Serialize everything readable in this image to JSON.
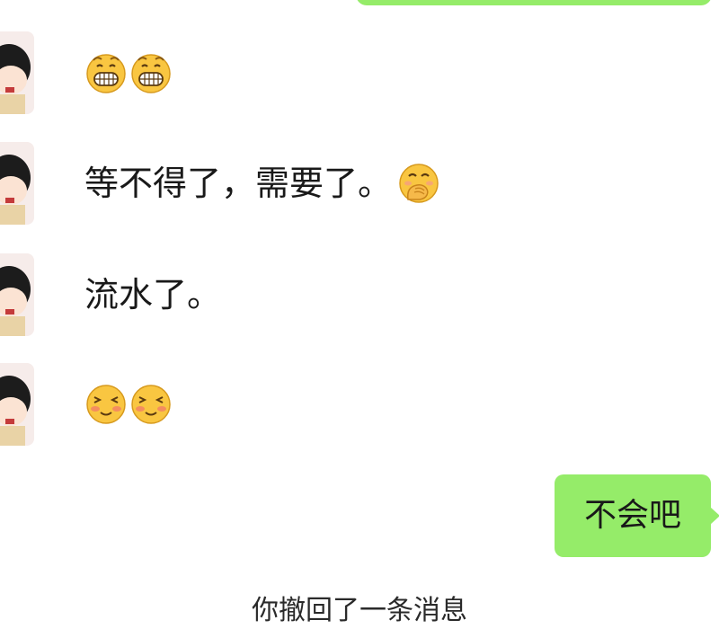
{
  "messages": [
    {
      "sender": "contact",
      "avatar_icon": "chibi-girl-avatar",
      "text": "",
      "emojis": [
        "grin-emoji",
        "grin-emoji"
      ]
    },
    {
      "sender": "contact",
      "avatar_icon": "chibi-girl-avatar",
      "text": "等不得了，需要了。",
      "emojis": [
        "face-with-hand-over-mouth-emoji"
      ]
    },
    {
      "sender": "contact",
      "avatar_icon": "chibi-girl-avatar",
      "text": "流水了。",
      "emojis": []
    },
    {
      "sender": "contact",
      "avatar_icon": "chibi-girl-avatar",
      "text": "",
      "emojis": [
        "blush-emoji",
        "blush-emoji"
      ]
    },
    {
      "sender": "me",
      "text": "不会吧"
    }
  ],
  "system_notice": "你撤回了一条消息",
  "colors": {
    "outgoing_bubble": "#95ec69",
    "background": "#ffffff",
    "emoji_yellow": "#f9c641"
  }
}
